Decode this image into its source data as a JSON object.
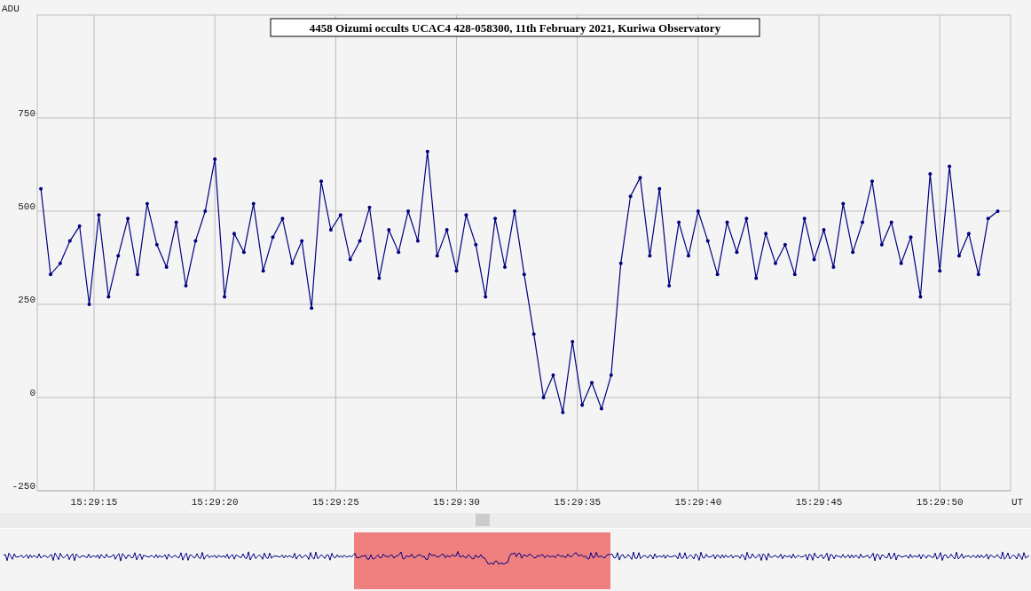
{
  "chart": {
    "chart_data": {
      "type": "line",
      "title": "4458 Oizumi occults UCAC4 428-058300, 11th February 2021, Kuriwa Observatory",
      "xlabel": "UT",
      "ylabel": "ADU",
      "x": [
        55752.8,
        55753.2,
        55753.6,
        55754.0,
        55754.4,
        55754.8,
        55755.2,
        55755.6,
        55756.0,
        55756.4,
        55756.8,
        55757.2,
        55757.6,
        55758.0,
        55758.4,
        55758.8,
        55759.2,
        55759.6,
        55760.0,
        55760.4,
        55760.8,
        55761.2,
        55761.6,
        55762.0,
        55762.4,
        55762.8,
        55763.2,
        55763.6,
        55764.0,
        55764.4,
        55764.8,
        55765.2,
        55765.6,
        55766.0,
        55766.4,
        55766.8,
        55767.2,
        55767.6,
        55768.0,
        55768.4,
        55768.8,
        55769.2,
        55769.6,
        55770.0,
        55770.4,
        55770.8,
        55771.2,
        55771.6,
        55772.0,
        55772.4,
        55772.8,
        55773.2,
        55773.6,
        55774.0,
        55774.4,
        55774.8,
        55775.2,
        55775.6,
        55776.0,
        55776.4,
        55776.8,
        55777.2,
        55777.6,
        55778.0,
        55778.4,
        55778.8,
        55779.2,
        55779.6,
        55780.0,
        55780.4,
        55780.8,
        55781.2,
        55781.6,
        55782.0,
        55782.4,
        55782.8,
        55783.2,
        55783.6,
        55784.0,
        55784.4,
        55784.8,
        55785.2,
        55785.6,
        55786.0,
        55786.4,
        55786.8,
        55787.2,
        55787.6,
        55788.0,
        55788.4,
        55788.8,
        55789.2,
        55789.6,
        55790.0,
        55790.4,
        55790.8,
        55791.2,
        55791.6,
        55792.0,
        55792.4
      ],
      "series": [
        {
          "color": "#000080",
          "values": [
            560,
            330,
            360,
            420,
            460,
            250,
            490,
            270,
            380,
            480,
            330,
            520,
            410,
            350,
            470,
            300,
            420,
            500,
            640,
            270,
            440,
            390,
            520,
            340,
            430,
            480,
            360,
            420,
            240,
            580,
            450,
            490,
            370,
            420,
            510,
            320,
            450,
            390,
            500,
            420,
            660,
            380,
            450,
            340,
            490,
            410,
            270,
            480,
            350,
            500,
            330,
            170,
            0,
            60,
            -40,
            150,
            -20,
            40,
            -30,
            60,
            360,
            540,
            590,
            380,
            560,
            300,
            470,
            380,
            500,
            420,
            330,
            470,
            390,
            480,
            320,
            440,
            360,
            410,
            330,
            480,
            370,
            450,
            350,
            520,
            390,
            470,
            580,
            410,
            470,
            360,
            430,
            270,
            600,
            340,
            620,
            380,
            440,
            330,
            480,
            500
          ]
        }
      ],
      "grid": true,
      "xlim": [
        55752.65,
        55792.93
      ],
      "ylim": [
        -250,
        1026
      ],
      "xticks": [
        {
          "value": 55755,
          "label": "15:29:15"
        },
        {
          "value": 55760,
          "label": "15:29:20"
        },
        {
          "value": 55765,
          "label": "15:29:25"
        },
        {
          "value": 55770,
          "label": "15:29:30"
        },
        {
          "value": 55775,
          "label": "15:29:35"
        },
        {
          "value": 55780,
          "label": "15:29:40"
        },
        {
          "value": 55785,
          "label": "15:29:45"
        },
        {
          "value": 55790,
          "label": "15:29:50"
        }
      ],
      "yticks": [
        -250,
        0,
        250,
        500,
        750
      ]
    }
  }
}
